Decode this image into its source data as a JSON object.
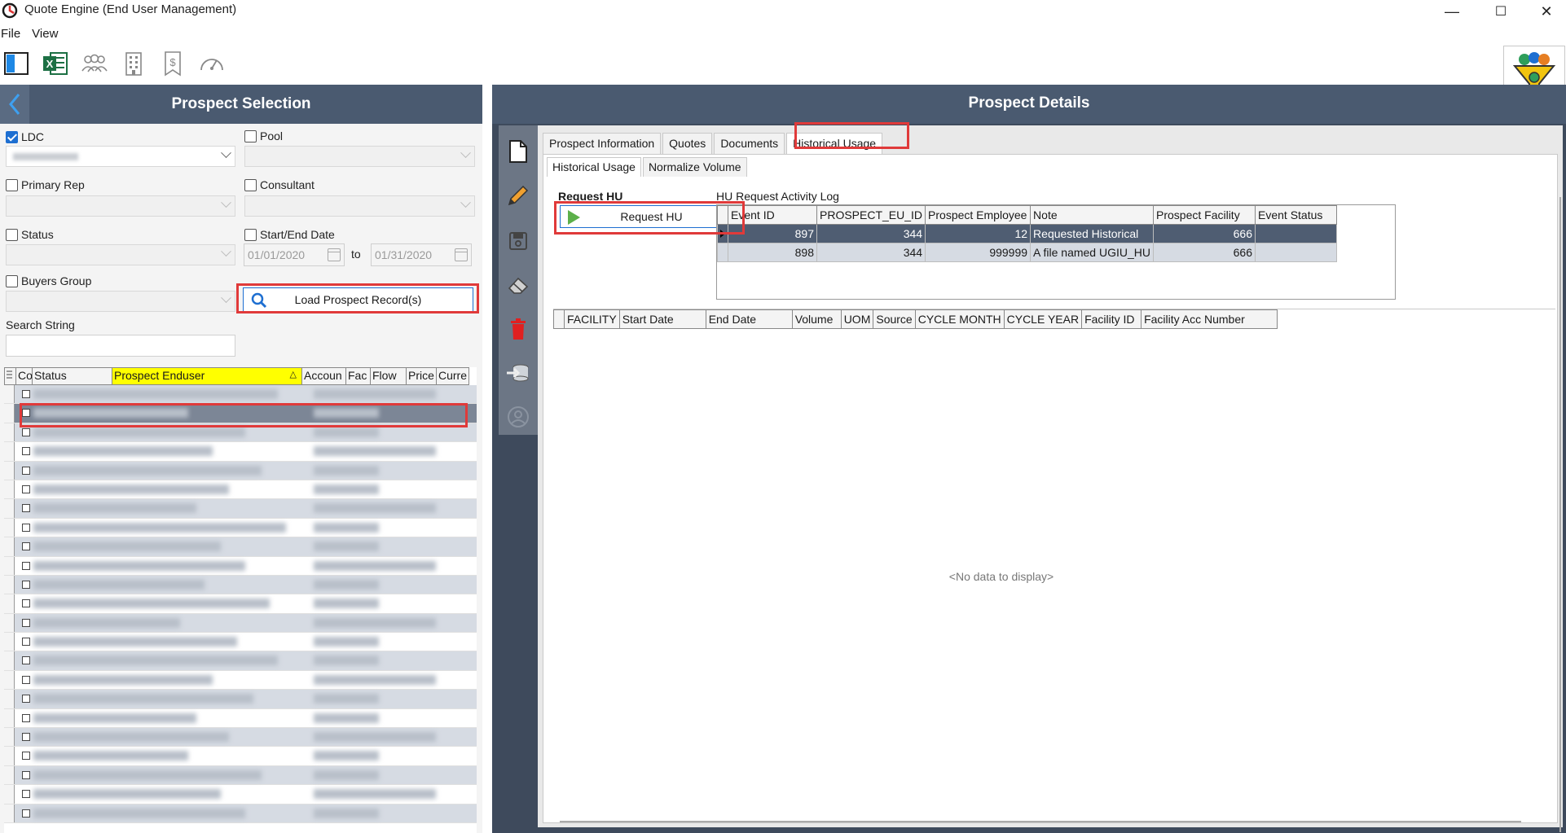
{
  "window": {
    "title": "Quote Engine (End User Management)",
    "min": "—",
    "max": "☐",
    "close": "✕"
  },
  "menu": [
    "File",
    "View"
  ],
  "toolbar_icons": [
    "panel-layout-icon",
    "excel-icon",
    "users-group-icon",
    "building-icon",
    "bookmark-dollar-icon",
    "dashboard-gauge-icon"
  ],
  "left": {
    "title": "Prospect Selection",
    "ldc_label": "LDC",
    "ldc_checked": true,
    "pool_label": "Pool",
    "primary_rep_label": "Primary Rep",
    "consultant_label": "Consultant",
    "status_label": "Status",
    "start_end_label": "Start/End Date",
    "start_date": "01/01/2020",
    "to_label": "to",
    "end_date": "01/31/2020",
    "buyers_group_label": "Buyers Group",
    "load_button": "Load Prospect Record(s)",
    "search_label": "Search String",
    "grid_headers": [
      "Co",
      "Status",
      "Prospect Enduser",
      "Accoun",
      "Fac",
      "Flow",
      "Price",
      "Curre"
    ],
    "sort_glyph": "△"
  },
  "right": {
    "title": "Prospect Details",
    "tabs": [
      "Prospect Information",
      "Quotes",
      "Documents",
      "Historical Usage"
    ],
    "subtabs": [
      "Historical Usage",
      "Normalize Volume"
    ],
    "request_title": "Request HU",
    "request_button": "Request HU",
    "log_title": "HU Request Activity Log",
    "log_headers": [
      "Event ID",
      "PROSPECT_EU_ID",
      "Prospect Employee",
      "Note",
      "Prospect Facility",
      "Event Status"
    ],
    "log_rows": [
      {
        "event_id": "897",
        "eu_id": "344",
        "employee": "12",
        "note": "Requested Historical",
        "facility": "666",
        "status": ""
      },
      {
        "event_id": "898",
        "eu_id": "344",
        "employee": "999999",
        "note": "A file named UGIU_HU",
        "facility": "666",
        "status": ""
      }
    ],
    "hu_headers": [
      "FACILITY",
      "Start Date",
      "End Date",
      "Volume",
      "UOM",
      "Source",
      "CYCLE MONTH",
      "CYCLE YEAR",
      "Facility ID",
      "Facility Acc Number"
    ],
    "no_data": "<No data to display>"
  },
  "colors": {
    "header_bg": "#4a5a70",
    "accent_blue": "#1e6fd1",
    "highlight_red": "#e03a3a",
    "selected_row": "#4f5d72",
    "sort_header": "#ffff00"
  }
}
